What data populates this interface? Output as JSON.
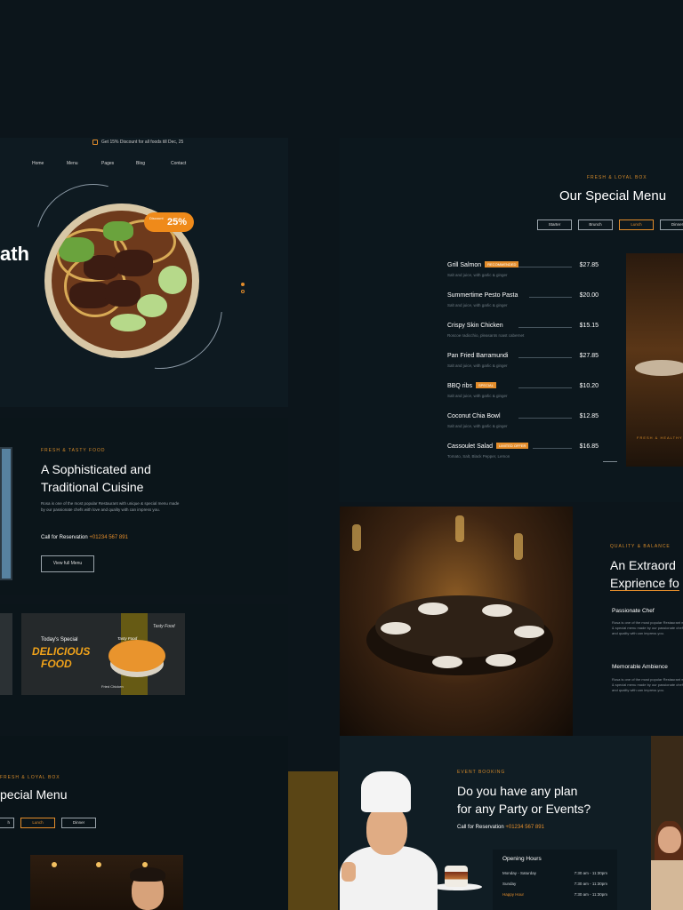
{
  "hero": {
    "announcement": "Get 15% Discount for all foods till Dec, 25",
    "nav": [
      "Home",
      "Menu",
      "Pages",
      "Blog",
      "Contact"
    ],
    "headline_fragment": "ath",
    "discount_label": "Discount",
    "discount_value": "25%"
  },
  "special_menu": {
    "kicker": "FRESH & LOYAL BOX",
    "title": "Our Special Menu",
    "tabs": [
      "Starter",
      "Brunch",
      "Lunch",
      "Dinner"
    ],
    "active_tab": "Lunch",
    "items": [
      {
        "name": "Grill Salmon",
        "badge": "RECOMMENDED",
        "price": "$27.85",
        "desc": "Salt and juice, with garlic & ginger"
      },
      {
        "name": "Summertime Pesto Pasta",
        "badge": "",
        "price": "$20.00",
        "desc": "Salt and juice, with garlic & ginger"
      },
      {
        "name": "Crispy Skin Chicken",
        "badge": "",
        "price": "$15.15",
        "desc": "Roscoe radicchio, pleasants roast cabernet"
      },
      {
        "name": "Pan Fried Barramundi",
        "badge": "",
        "price": "$27.85",
        "desc": "Salt and juice, with garlic & ginger"
      },
      {
        "name": "BBQ ribs",
        "badge": "SPECIAL",
        "price": "$10.20",
        "desc": "Salt and juice, with garlic & ginger"
      },
      {
        "name": "Coconut Chia Bowl",
        "badge": "",
        "price": "$12.85",
        "desc": "Salt and juice, with garlic & ginger"
      },
      {
        "name": "Cassoulet Salad",
        "badge": "LIMITED OFFER",
        "price": "$16.85",
        "desc": "Tomato, Salt, Black Pepper, Lemon"
      }
    ],
    "photo_caption": "FRESH & HEALTHY"
  },
  "cuisine": {
    "kicker": "FRESH & TASTY FOOD",
    "title_line1": "A Sophisticated and",
    "title_line2": "Traditional Cuisine",
    "body": "Rosa is one of the most popular Restaurant with unique & special menu made by our passionate chefs with love and quality with can impress you.",
    "call_label": "Call for Reservation",
    "call_number": "+01234 567 891",
    "button": "View full Menu"
  },
  "todays_special": {
    "label": "Today's Special",
    "title_line1": "DELICIOUS",
    "title_line2": "FOOD",
    "tag_top": "Tasty Food",
    "tag_mid": "Tasty Food",
    "tag_bottom": "Fried Chicken"
  },
  "experience": {
    "kicker": "QUALITY & BALANCE",
    "title_line1": "An Extraord",
    "title_line2": "Exprience fo",
    "feature1_title": "Passionate Chef",
    "feature1_body": "Rosa is one of the most popular Restaurant with unique & special menu made by our passionate chefs with love and quality with can impress you.",
    "feature2_title": "Memorable Ambience",
    "feature2_body": "Rosa is one of the most popular Restaurant with unique & special menu made by our passionate chefs with love and quality with can impress you."
  },
  "bottom_menu": {
    "kicker": "FRESH & LOYAL BOX",
    "title": "pecial Menu",
    "tabs": [
      "h",
      "Lunch",
      "Dinner"
    ],
    "active_tab": "Lunch"
  },
  "events": {
    "kicker": "EVENT BOOKING",
    "title_line1": "Do you have any plan",
    "title_line2": "for any Party or Events?",
    "call_label": "Call for Reservation",
    "call_number": "+01234 567 891",
    "hours_title": "Opening Hours",
    "hours": [
      {
        "day": "Monday - Saturday",
        "time": "7:30 am - 11:30pm",
        "highlight": false
      },
      {
        "day": "Sunday",
        "time": "7:30 am - 11:30pm",
        "highlight": false
      },
      {
        "day": "Happy Hour",
        "time": "7:30 am - 11:30pm",
        "highlight": true
      }
    ]
  },
  "colors": {
    "accent": "#e48d2b",
    "background": "#0c151b",
    "panel": "#0e1a21"
  }
}
